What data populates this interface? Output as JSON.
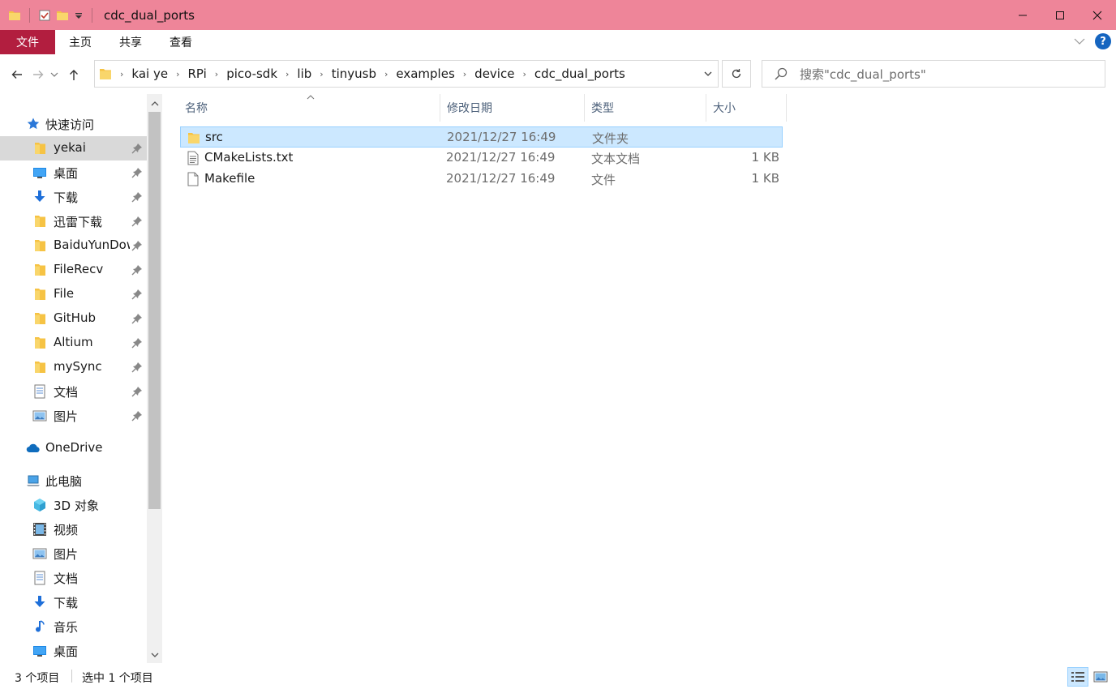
{
  "window": {
    "title": "cdc_dual_ports",
    "minimize_icon": "minimize-icon",
    "maximize_icon": "maximize-icon",
    "close_icon": "close-icon"
  },
  "ribbon": {
    "tabs": [
      "文件",
      "主页",
      "共享",
      "查看"
    ],
    "help_label": "?"
  },
  "address": {
    "crumbs": [
      "kai ye",
      "RPi",
      "pico-sdk",
      "lib",
      "tinyusb",
      "examples",
      "device",
      "cdc_dual_ports"
    ]
  },
  "search": {
    "placeholder": "搜索\"cdc_dual_ports\""
  },
  "nav": {
    "quick_access": "快速访问",
    "pinned": [
      {
        "label": "yekai",
        "icon": "folder-icon"
      },
      {
        "label": "桌面",
        "icon": "desktop-icon"
      },
      {
        "label": "下载",
        "icon": "download-icon"
      },
      {
        "label": "迅雷下载",
        "icon": "folder-icon"
      },
      {
        "label": "BaiduYunDownload",
        "icon": "folder-icon"
      },
      {
        "label": "FileRecv",
        "icon": "folder-icon"
      },
      {
        "label": "File",
        "icon": "folder-icon"
      },
      {
        "label": "GitHub",
        "icon": "folder-icon"
      },
      {
        "label": "Altium",
        "icon": "folder-icon"
      },
      {
        "label": "mySync",
        "icon": "folder-icon"
      },
      {
        "label": "文档",
        "icon": "document-icon"
      },
      {
        "label": "图片",
        "icon": "picture-icon"
      }
    ],
    "onedrive": "OneDrive",
    "this_pc": "此电脑",
    "pc_items": [
      {
        "label": "3D 对象",
        "icon": "3d-objects-icon"
      },
      {
        "label": "视频",
        "icon": "video-icon"
      },
      {
        "label": "图片",
        "icon": "picture-icon"
      },
      {
        "label": "文档",
        "icon": "document-icon"
      },
      {
        "label": "下载",
        "icon": "download-icon"
      },
      {
        "label": "音乐",
        "icon": "music-icon"
      },
      {
        "label": "桌面",
        "icon": "desktop-icon"
      }
    ]
  },
  "columns": [
    "名称",
    "修改日期",
    "类型",
    "大小"
  ],
  "files": [
    {
      "name": "src",
      "date": "2021/12/27 16:49",
      "type": "文件夹",
      "size": "",
      "icon": "folder-icon",
      "selected": true
    },
    {
      "name": "CMakeLists.txt",
      "date": "2021/12/27 16:49",
      "type": "文本文档",
      "size": "1 KB",
      "icon": "text-file-icon",
      "selected": false
    },
    {
      "name": "Makefile",
      "date": "2021/12/27 16:49",
      "type": "文件",
      "size": "1 KB",
      "icon": "file-icon",
      "selected": false
    }
  ],
  "status": {
    "count": "3 个项目",
    "selection": "选中 1 个项目"
  },
  "colors": {
    "titlebar": "#ee8599",
    "file_tab": "#b21e3f",
    "selection": "#cce8ff"
  }
}
